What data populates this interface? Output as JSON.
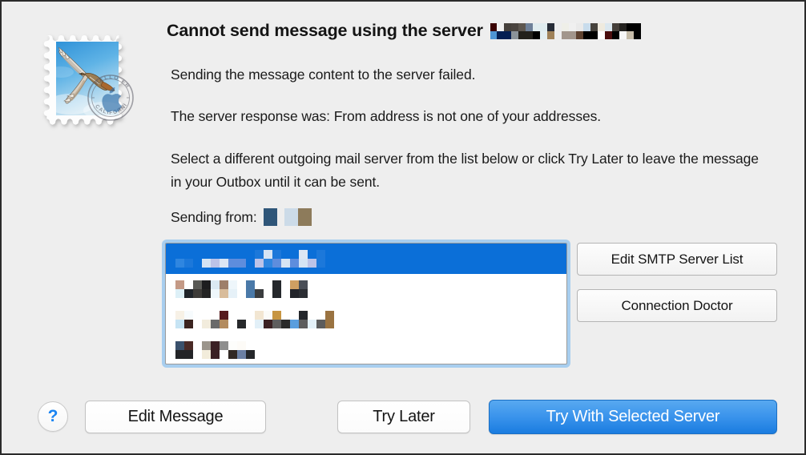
{
  "window": {
    "app": "Mail",
    "icon_name": "mail-stamp-icon"
  },
  "alert": {
    "title_text": "Cannot send message using the server",
    "paragraph_1": "Sending the message content to the server failed.",
    "paragraph_2": "The server response was: From address is not one of your addresses.",
    "paragraph_3": "Select a different outgoing mail server from the list below or click Try Later to leave the message in your Outbox until it can be sent.",
    "sending_from_label": "Sending from:"
  },
  "redactions": {
    "title_server_name": [
      {
        "w": 8,
        "top": "#3a0202",
        "bottom": "#4f95d4"
      },
      {
        "w": 9,
        "top": "#f0f0f0",
        "bottom": "#051f52"
      },
      {
        "w": 9,
        "top": "#45403b",
        "bottom": "#051f52"
      },
      {
        "w": 9,
        "top": "#4a443f",
        "bottom": "#8b9399"
      },
      {
        "w": 9,
        "top": "#5d564f",
        "bottom": "#22201b"
      },
      {
        "w": 9,
        "top": "#6e8099",
        "bottom": "#22201b"
      },
      {
        "w": 9,
        "top": "#e0ecef",
        "bottom": "#000000"
      },
      {
        "w": 9,
        "top": "#e0ecef",
        "bottom": "#e3eef1"
      },
      {
        "w": 9,
        "top": "#282d38",
        "bottom": "#a08259"
      }
    ],
    "title_server_name_2": [
      {
        "w": 9,
        "top": "#efefe8",
        "bottom": "#a2968c"
      },
      {
        "w": 9,
        "top": "#f0f0f0",
        "bottom": "#a2968c"
      },
      {
        "w": 9,
        "top": "#eaeaea",
        "bottom": "#5e4230"
      },
      {
        "w": 9,
        "top": "#c8dcec",
        "bottom": "#000000"
      },
      {
        "w": 9,
        "top": "#46423c",
        "bottom": "#000000"
      },
      {
        "w": 9,
        "top": "#efeade",
        "bottom": "#ffffff"
      },
      {
        "w": 9,
        "top": "#dbe7ef",
        "bottom": "#4b0e0e"
      },
      {
        "w": 9,
        "top": "#453f3a",
        "bottom": "#000000"
      },
      {
        "w": 9,
        "top": "#24221f",
        "bottom": "#f7f7f7"
      },
      {
        "w": 9,
        "top": "#000000",
        "bottom": "#c6bca9"
      },
      {
        "w": 9,
        "top": "#000000",
        "bottom": "#000000"
      }
    ],
    "sending_from_value": [
      {
        "w": 17,
        "top": "#2f5679",
        "bottom": "#2f5679"
      },
      {
        "w": 9,
        "top": "#eeeeee",
        "bottom": "#eeeeee"
      },
      {
        "w": 17,
        "top": "#ccdbe8",
        "bottom": "#ccdbe8"
      },
      {
        "w": 17,
        "top": "#8d7b5b",
        "bottom": "#8d7b5b"
      }
    ],
    "list_row_1": [
      {
        "w": 11,
        "top": "#0b6fd8",
        "bottom": "#2f86e0"
      },
      {
        "w": 11,
        "top": "#0b6fd8",
        "bottom": "#1c78da"
      },
      {
        "w": 11,
        "top": "#0b6fd8",
        "bottom": "#0b6fd8"
      },
      {
        "w": 11,
        "top": "#0b6fd8",
        "bottom": "#d5e4f4"
      },
      {
        "w": 11,
        "top": "#0b6fd8",
        "bottom": "#bcc3e8"
      },
      {
        "w": 11,
        "top": "#0b6fd8",
        "bottom": "#dbe6f4"
      },
      {
        "w": 11,
        "top": "#0b6fd8",
        "bottom": "#5e8ddd"
      },
      {
        "w": 11,
        "top": "#0b6fd8",
        "bottom": "#5e8ddd"
      },
      {
        "w": 11,
        "top": "#0b6fd8",
        "bottom": "#0b6fd8"
      },
      {
        "w": 11,
        "top": "#1c78da",
        "bottom": "#bcc3e8"
      },
      {
        "w": 11,
        "top": "#d5e4f4",
        "bottom": "#2f86e0"
      },
      {
        "w": 11,
        "top": "#1c78da",
        "bottom": "#5e8ddd"
      },
      {
        "w": 11,
        "top": "#0b6fd8",
        "bottom": "#d5e4f4"
      },
      {
        "w": 11,
        "top": "#0b6fd8",
        "bottom": "#5e8ddd"
      },
      {
        "w": 11,
        "top": "#dbe6f4",
        "bottom": "#d5e4f4"
      },
      {
        "w": 11,
        "top": "#0b6fd8",
        "bottom": "#bcc3e8"
      },
      {
        "w": 11,
        "top": "#1c78da",
        "bottom": "#1c78da"
      }
    ],
    "list_row_2": [
      {
        "w": 11,
        "top": "#c49a86",
        "bottom": "#ddf0f7"
      },
      {
        "w": 11,
        "top": "#ffffff",
        "bottom": "#1f242a"
      },
      {
        "w": 11,
        "top": "#5a5a56",
        "bottom": "#3d3b38"
      },
      {
        "w": 11,
        "top": "#1d1d1f",
        "bottom": "#242424"
      },
      {
        "w": 11,
        "top": "#dbe9f2",
        "bottom": "#eff7fb"
      },
      {
        "w": 11,
        "top": "#9e7f69",
        "bottom": "#d8bc9b"
      },
      {
        "w": 11,
        "top": "#eef6fb",
        "bottom": "#e6f1f8"
      },
      {
        "w": 11,
        "top": "#ffffff",
        "bottom": "#ffffff"
      },
      {
        "w": 11,
        "top": "#4a79a8",
        "bottom": "#4a79a8"
      },
      {
        "w": 11,
        "top": "#ffffff",
        "bottom": "#3a3c3e"
      },
      {
        "w": 11,
        "top": "#ffffff",
        "bottom": "#ffffff"
      },
      {
        "w": 11,
        "top": "#25282c",
        "bottom": "#25282c"
      },
      {
        "w": 11,
        "top": "#ffffff",
        "bottom": "#ffffff"
      },
      {
        "w": 11,
        "top": "#cf9f62",
        "bottom": "#22242a"
      },
      {
        "w": 11,
        "top": "#4a4f57",
        "bottom": "#2b2e33"
      }
    ],
    "list_row_3": [
      {
        "w": 11,
        "top": "#f7f1e6",
        "bottom": "#c6e4f4"
      },
      {
        "w": 11,
        "top": "#f7fbfd",
        "bottom": "#3b2420"
      },
      {
        "w": 11,
        "top": "#ffffff",
        "bottom": "#ffffff"
      },
      {
        "w": 11,
        "top": "#ffffff",
        "bottom": "#f2ecdd"
      },
      {
        "w": 11,
        "top": "#ffffff",
        "bottom": "#6a6a6a"
      },
      {
        "w": 11,
        "top": "#56191c",
        "bottom": "#b38b5e"
      },
      {
        "w": 11,
        "top": "#ffffff",
        "bottom": "#ffffff"
      },
      {
        "w": 11,
        "top": "#ffffff",
        "bottom": "#27292b"
      },
      {
        "w": 11,
        "top": "#ffffff",
        "bottom": "#ffffff"
      },
      {
        "w": 11,
        "top": "#f2e6d2",
        "bottom": "#e2f0f8"
      },
      {
        "w": 11,
        "top": "#fbfbf8",
        "bottom": "#3b2224"
      },
      {
        "w": 11,
        "top": "#c79541",
        "bottom": "#5e5e5e"
      },
      {
        "w": 11,
        "top": "#ffffff",
        "bottom": "#2a2a2a"
      },
      {
        "w": 11,
        "top": "#ffffff",
        "bottom": "#5a9ede"
      },
      {
        "w": 11,
        "top": "#23262b",
        "bottom": "#5d5d5d"
      },
      {
        "w": 11,
        "top": "#ffffff",
        "bottom": "#e4f1f8"
      },
      {
        "w": 11,
        "top": "#ffffff",
        "bottom": "#5d5d5d"
      },
      {
        "w": 11,
        "top": "#9a7341",
        "bottom": "#9a7341"
      }
    ],
    "list_row_4": [
      {
        "w": 11,
        "top": "#3a516c",
        "bottom": "#232427"
      },
      {
        "w": 11,
        "top": "#4a2a26",
        "bottom": "#232427"
      },
      {
        "w": 11,
        "top": "#ffffff",
        "bottom": "#ffffff"
      },
      {
        "w": 11,
        "top": "#9b958c",
        "bottom": "#f2ecdb"
      },
      {
        "w": 11,
        "top": "#3a2024",
        "bottom": "#3a2024"
      },
      {
        "w": 11,
        "top": "#8e8e8e",
        "bottom": "#ffffff"
      },
      {
        "w": 11,
        "top": "#fdfdfb",
        "bottom": "#312824"
      },
      {
        "w": 11,
        "top": "#fdfbf7",
        "bottom": "#6b7fa3"
      },
      {
        "w": 11,
        "top": "#ffffff",
        "bottom": "#25272a"
      }
    ]
  },
  "side_buttons": {
    "edit_smtp_server_list": "Edit SMTP Server List",
    "connection_doctor": "Connection Doctor"
  },
  "bottom_buttons": {
    "help_glyph": "?",
    "edit_message": "Edit Message",
    "try_later": "Try Later",
    "try_with_selected_server": "Try With Selected Server"
  },
  "colors": {
    "dialog_background": "#eeeeee",
    "selection_blue": "#0b6fd8",
    "default_button_blue": "#3b94ec",
    "focus_ring_blue": "#a8ceef",
    "help_glyph_blue": "#1a84f2",
    "text_primary": "#1a1a1a"
  }
}
